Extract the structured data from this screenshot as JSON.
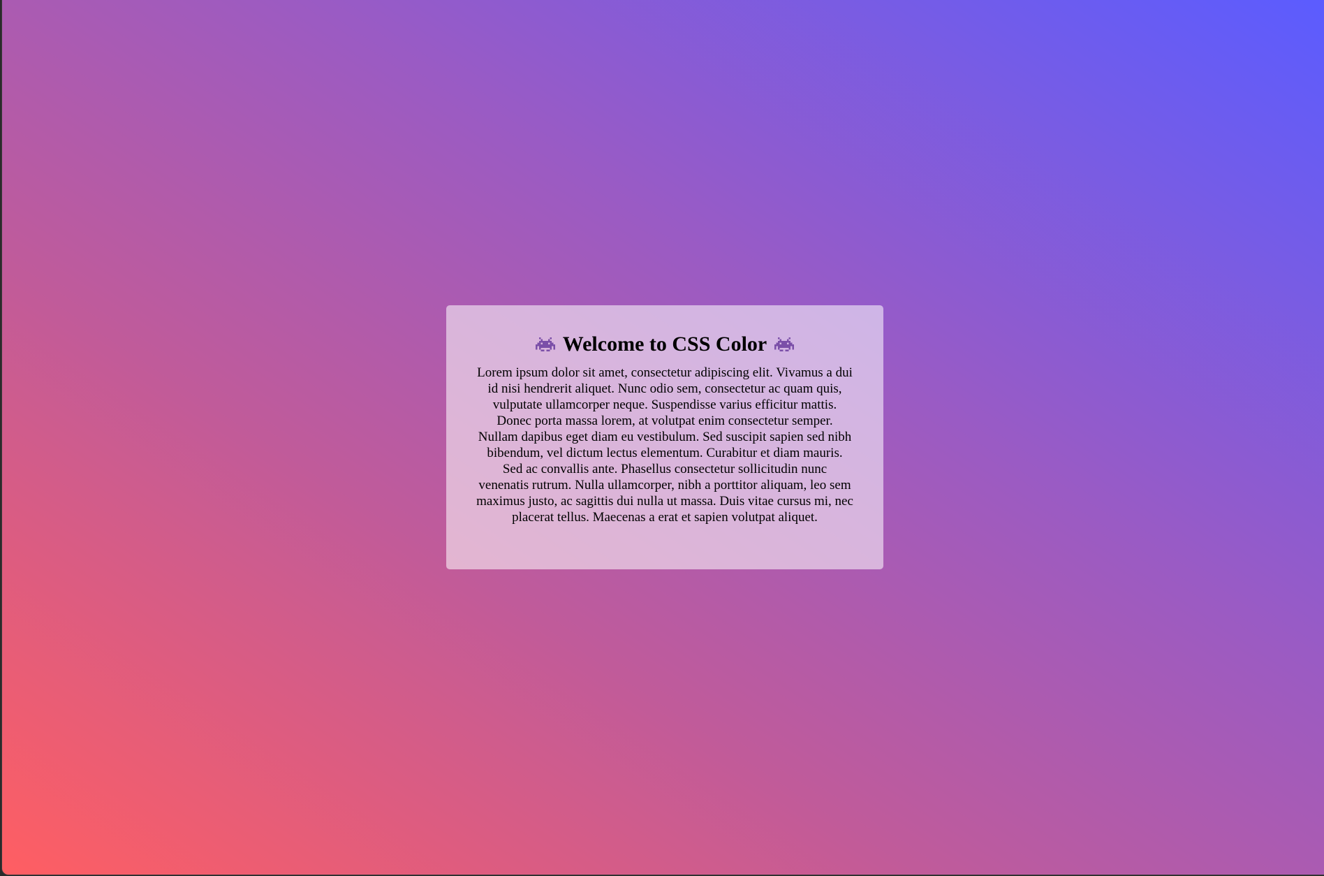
{
  "card": {
    "title": "Welcome to CSS Color",
    "leading_icon": "alien-monster-icon",
    "trailing_icon": "alien-monster-icon",
    "body": "Lorem ipsum dolor sit amet, consectetur adipiscing elit. Vivamus a dui id nisi hendrerit aliquet. Nunc odio sem, consectetur ac quam quis, vulputate ullamcorper neque. Suspendisse varius efficitur mattis. Donec porta massa lorem, at volutpat enim consectetur semper. Nullam dapibus eget diam eu vestibulum. Sed suscipit sapien sed nibh bibendum, vel dictum lectus elementum. Curabitur et diam mauris. Sed ac convallis ante. Phasellus consectetur sollicitudin nunc venenatis rutrum. Nulla ullamcorper, nibh a porttitor aliquam, leo sem maximus justo, ac sagittis dui nulla ut massa. Duis vitae cursus mi, nec placerat tellus. Maecenas a erat et sapien volutpat aliquet."
  },
  "colors": {
    "gradient_start": "#ff5e62",
    "gradient_mid": "#c05b9a",
    "gradient_end": "#5b5cff",
    "card_background": "rgba(255,255,255,0.55)",
    "text": "#000000",
    "icon": "#7b4fa8"
  }
}
